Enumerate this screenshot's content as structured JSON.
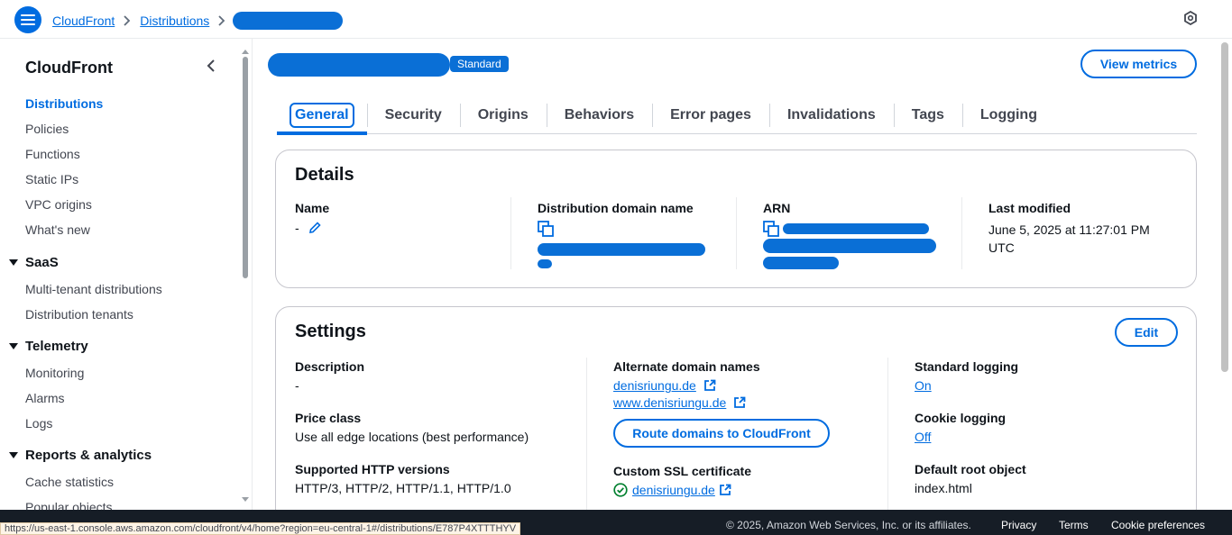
{
  "breadcrumb": {
    "items": [
      "CloudFront",
      "Distributions"
    ]
  },
  "sidebar": {
    "title": "CloudFront",
    "items": [
      "Distributions",
      "Policies",
      "Functions",
      "Static IPs",
      "VPC origins",
      "What's new"
    ],
    "groups": [
      {
        "label": "SaaS",
        "items": [
          "Multi-tenant distributions",
          "Distribution tenants"
        ]
      },
      {
        "label": "Telemetry",
        "items": [
          "Monitoring",
          "Alarms",
          "Logs"
        ]
      },
      {
        "label": "Reports & analytics",
        "items": [
          "Cache statistics",
          "Popular objects"
        ]
      }
    ]
  },
  "header": {
    "badge": "Standard",
    "view_metrics": "View metrics"
  },
  "tabs": [
    "General",
    "Security",
    "Origins",
    "Behaviors",
    "Error pages",
    "Invalidations",
    "Tags",
    "Logging"
  ],
  "details": {
    "title": "Details",
    "name_label": "Name",
    "name_value": "-",
    "domain_label": "Distribution domain name",
    "arn_label": "ARN",
    "modified_label": "Last modified",
    "modified_value": "June 5, 2025 at 11:27:01 PM UTC"
  },
  "settings": {
    "title": "Settings",
    "edit": "Edit",
    "description_label": "Description",
    "description_value": "-",
    "price_label": "Price class",
    "price_value": "Use all edge locations (best performance)",
    "http_label": "Supported HTTP versions",
    "http_value": "HTTP/3, HTTP/2, HTTP/1.1, HTTP/1.0",
    "alt_label": "Alternate domain names",
    "alt_domains": [
      "denisriungu.de",
      "www.denisriungu.de"
    ],
    "route_button": "Route domains to CloudFront",
    "ssl_label": "Custom SSL certificate",
    "ssl_value": "denisriungu.de",
    "std_logging_label": "Standard logging",
    "std_logging_value": "On",
    "cookie_label": "Cookie logging",
    "cookie_value": "Off",
    "root_label": "Default root object",
    "root_value": "index.html"
  },
  "footer": {
    "copyright": "© 2025, Amazon Web Services, Inc. or its affiliates.",
    "links": [
      "Privacy",
      "Terms",
      "Cookie preferences"
    ]
  },
  "status_url": "https://us-east-1.console.aws.amazon.com/cloudfront/v4/home?region=eu-central-1#/distributions/E787P4XTTTHYV"
}
